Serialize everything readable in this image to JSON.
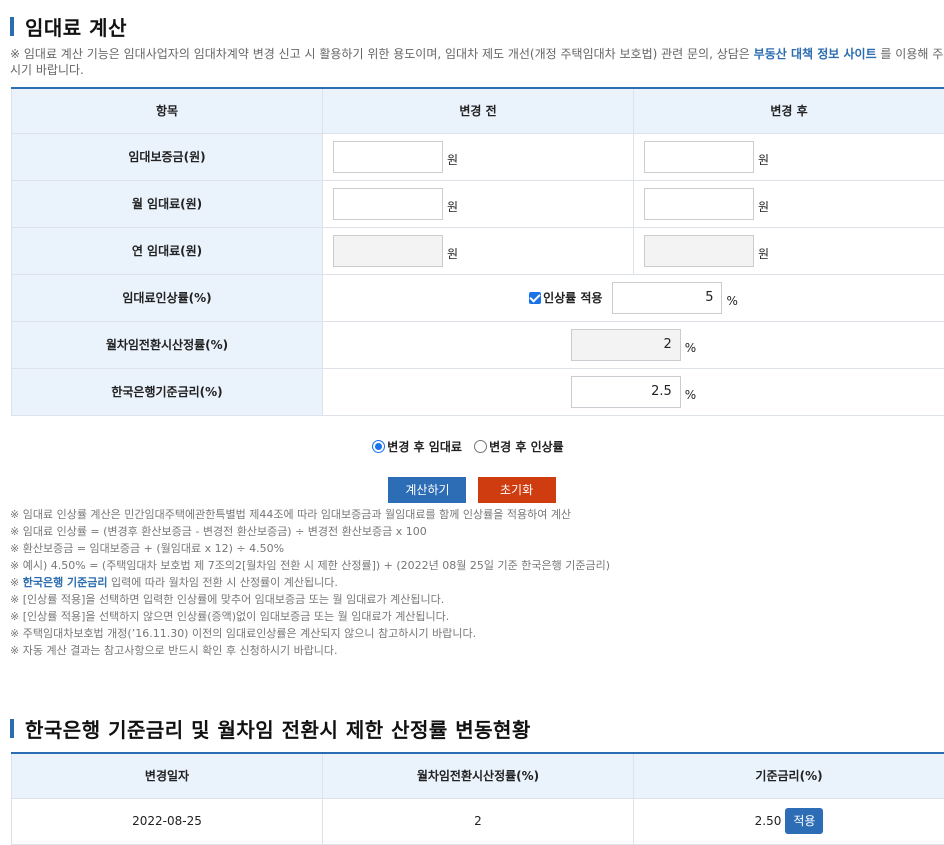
{
  "title": "임대료 계산",
  "intro": {
    "text": "※ 임대료 계산 기능은 임대사업자의 임대차계약 변경 신고 시 활용하기 위한 용도이며, 임대차 제도 개선(개정 주택임대차 보호법) 관련 문의, 상담은 ",
    "link": "부동산 대책 정보 사이트",
    "tail": " 를 이용해 주시기 바랍니다."
  },
  "calc": {
    "headers": [
      "항목",
      "변경 전",
      "변경 후"
    ],
    "deposit": {
      "label": "임대보증금(원)",
      "before": "",
      "after": "",
      "unit": "원"
    },
    "monthly": {
      "label": "월 임대료(원)",
      "before": "",
      "after": "",
      "unit": "원"
    },
    "yearly": {
      "label": "연 임대료(원)",
      "before": "",
      "after": "",
      "unit": "원"
    },
    "increase": {
      "label": "임대료인상률(%)",
      "checkbox_label": "인상률 적용",
      "value": "5",
      "unit": "%"
    },
    "conversion": {
      "label": "월차임전환시산정률(%)",
      "value": "2",
      "unit": "%"
    },
    "bok": {
      "label": "한국은행기준금리(%)",
      "value": "2.5",
      "unit": "%"
    }
  },
  "radios": [
    {
      "label": "변경 후 임대료",
      "selected": true
    },
    {
      "label": "변경 후 인상률",
      "selected": false
    }
  ],
  "buttons": {
    "calc": "계산하기",
    "reset": "초기화"
  },
  "notes": [
    "임대료 인상률 계산은 민간임대주택에관한특별법 제44조에 따라 임대보증금과 월임대료를 함께 인상률을 적용하여 계산",
    "임대료 인상률 = (변경후 환산보증금 - 변경전 환산보증금) ÷ 변경전 환산보증금 x 100",
    "환산보증금 = 임대보증금 + (월임대료 x 12) ÷ 4.50%",
    "예시) 4.50% = (주택임대차 보호법 제 7조의2[월차임 전환 시 제한 산정률]) + (2022년 08월 25일 기준 한국은행 기준금리)",
    "입력에 따라 월차임 전환 시 산정률이 계산됩니다.",
    "[인상률 적용]을 선택하면 입력한 인상률에 맞추어 임대보증금 또는 월 임대료가 계산됩니다.",
    "[인상률 적용]을 선택하지 않으면 인상률(증액)없이 임대보증금 또는 월 임대료가 계산됩니다.",
    "주택임대차보호법 개정(’16.11.30) 이전의 임대료인상률은 계산되지 않으니 참고하시기 바랍니다.",
    "자동 계산 결과는 참고사항으로 반드시 확인 후 신청하시기 바랍니다."
  ],
  "note_link": "한국은행 기준금리",
  "section2": {
    "title": "한국은행 기준금리 및 월차임 전환시 제한 산정률 변동현황",
    "headers": [
      "변경일자",
      "월차임전환시산정률(%)",
      "기준금리(%)"
    ],
    "rows": [
      {
        "date": "2022-08-25",
        "conversion": "2",
        "rate": "2.50",
        "apply": "적용"
      }
    ]
  }
}
